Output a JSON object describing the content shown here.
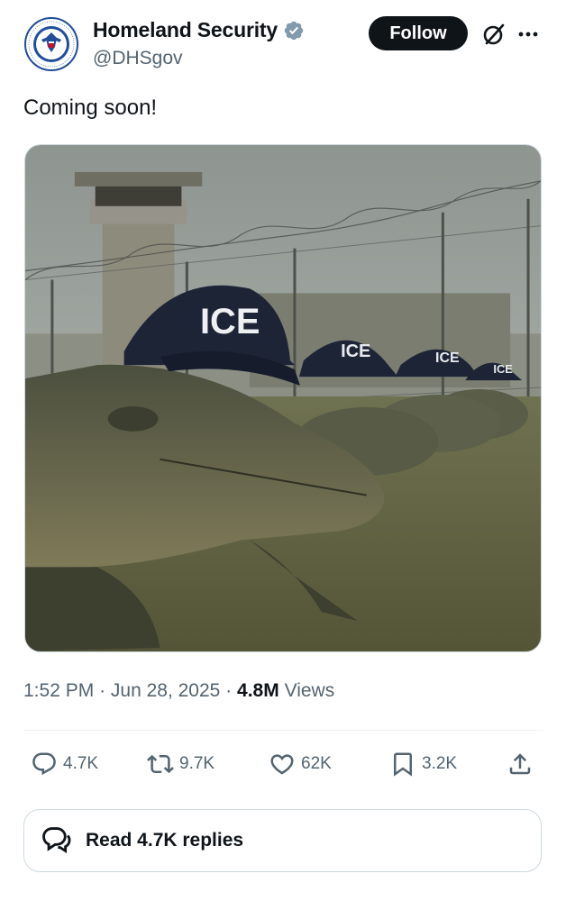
{
  "account": {
    "display_name": "Homeland Security",
    "handle": "@DHSgov",
    "verified": true,
    "avatar_seal_text_top": "U.S. DEPARTMENT OF",
    "avatar_seal_text_bottom": "HOMELAND SECURITY"
  },
  "header": {
    "follow_label": "Follow",
    "grok_icon": "grok-icon",
    "more_icon": "more-options-icon"
  },
  "tweet": {
    "text": "Coming soon!",
    "image": {
      "cap_text": "ICE"
    },
    "time": "1:52 PM",
    "separator": "·",
    "date": "Jun 28, 2025",
    "views_count": "4.8M",
    "views_label": "Views"
  },
  "actions": {
    "replies": "4.7K",
    "reposts": "9.7K",
    "likes": "62K",
    "bookmarks": "3.2K",
    "share_icon": "share-icon"
  },
  "read_replies": {
    "label": "Read 4.7K replies"
  },
  "colors": {
    "text_primary": "#0f1419",
    "text_secondary": "#536471",
    "verified_badge": "#829aab",
    "follow_bg": "#0f1419",
    "border": "#cfd9de"
  }
}
